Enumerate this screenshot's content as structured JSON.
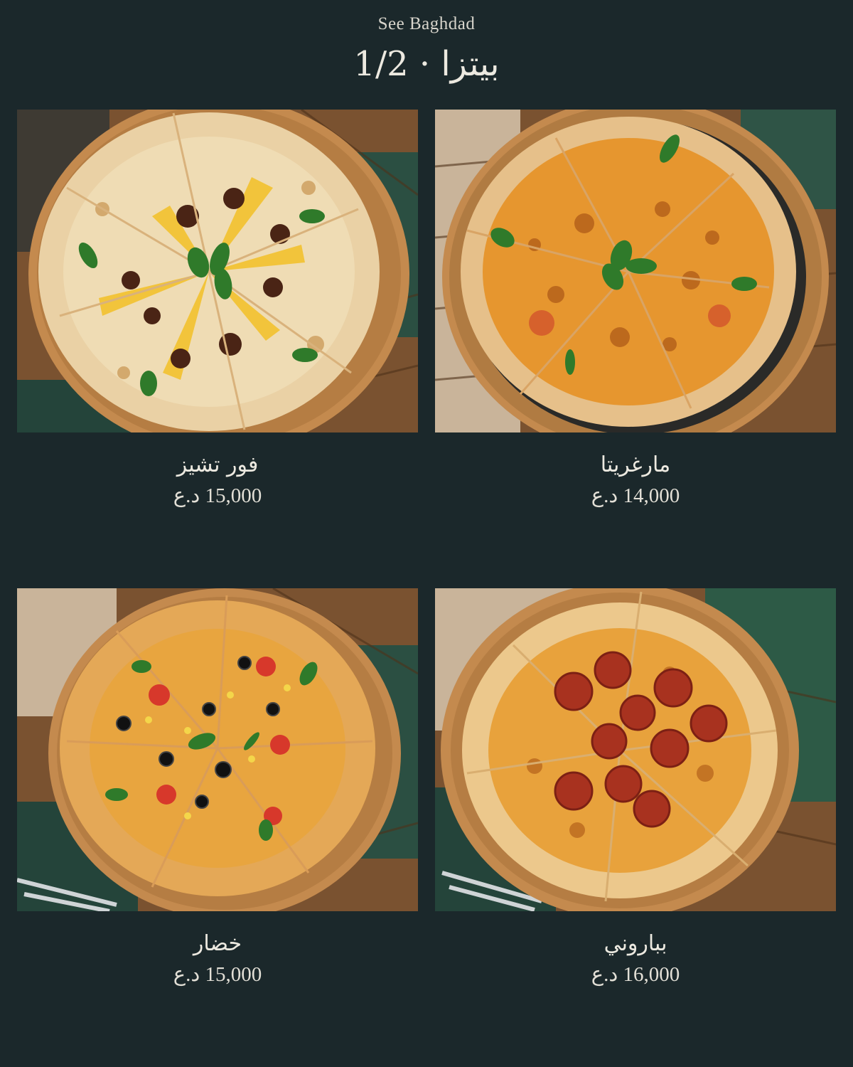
{
  "header": {
    "brand": "See Baghdad",
    "title": "بيتزا · 1/2"
  },
  "menu": {
    "items": [
      {
        "name": "مارغريتا",
        "price": "14,000",
        "currency": "د.ع",
        "image": "margherita-pizza-photo"
      },
      {
        "name": "فور تشيز",
        "price": "15,000",
        "currency": "د.ع",
        "image": "four-cheese-pizza-photo"
      },
      {
        "name": "بباروني",
        "price": "16,000",
        "currency": "د.ع",
        "image": "pepperoni-pizza-photo"
      },
      {
        "name": "خضار",
        "price": "15,000",
        "currency": "د.ع",
        "image": "vegetable-pizza-photo"
      }
    ]
  },
  "colors": {
    "background": "#1b282b",
    "text": "#ece9e0",
    "wood": "#a9743d",
    "crust": "#e3b26a",
    "cheese": "#e7a33a",
    "placemat": "#24443a"
  }
}
